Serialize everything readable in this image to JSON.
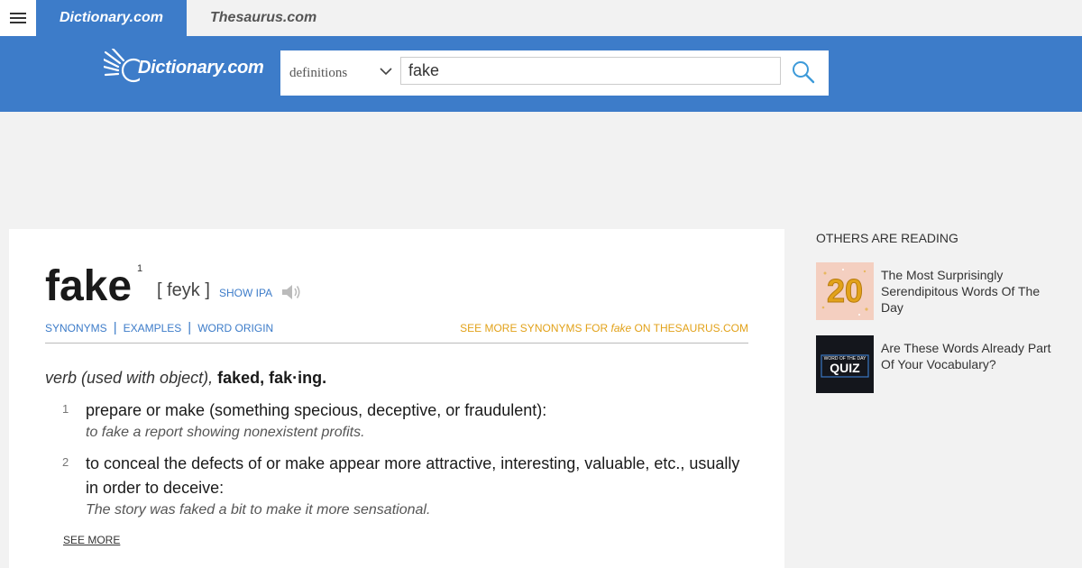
{
  "topbar": {
    "menu_icon": "hamburger-menu-icon",
    "tabs": [
      {
        "label": "Dictionary.com"
      },
      {
        "label": "Thesaurus.com"
      }
    ]
  },
  "header": {
    "logo_text": "Dictionary.com",
    "search": {
      "select_value": "definitions",
      "input_value": "fake",
      "search_icon": "search-icon"
    }
  },
  "entry": {
    "word": "fake",
    "superscript": "1",
    "pronunciation": "[ feyk ]",
    "show_ipa": "SHOW IPA",
    "links": [
      "SYNONYMS",
      "EXAMPLES",
      "WORD ORIGIN"
    ],
    "see_more_syn": {
      "prefix": "SEE MORE SYNONYMS FOR",
      "word": "fake",
      "suffix": "ON THESAURUS.COM"
    },
    "pos_label": "verb (used with object),",
    "forms": "faked, fak·ing.",
    "definitions": [
      {
        "num": "1",
        "text": "prepare or make (something specious, deceptive, or fraudulent):",
        "example": "to fake a report showing nonexistent profits."
      },
      {
        "num": "2",
        "text": "to conceal the defects of or make appear more attractive, interesting, valuable, etc., usually in order to deceive:",
        "example": "The story was faked a bit to make it more sensational."
      }
    ],
    "see_more": "SEE MORE"
  },
  "sidebar": {
    "title": "OTHERS ARE READING",
    "items": [
      {
        "title": "The Most Surprisingly Serendipitous Words Of The Day",
        "thumb_text": "20"
      },
      {
        "title": "Are These Words Already Part Of Your Vocabulary?",
        "thumb_text": "QUIZ",
        "thumb_sub": "WORD OF THE DAY"
      }
    ]
  },
  "colors": {
    "brand_blue": "#3d7cc9",
    "accent_orange": "#e2a21a"
  }
}
